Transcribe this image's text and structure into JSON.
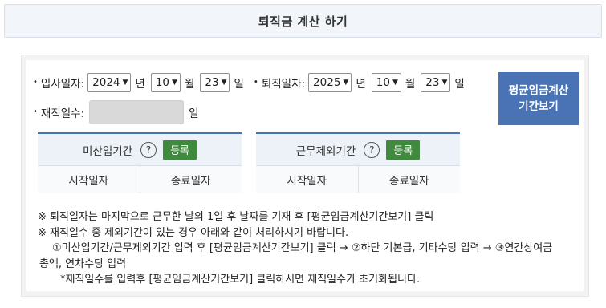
{
  "header": {
    "title": "퇴직금 계산 하기"
  },
  "dates": {
    "start_label": "입사일자:",
    "start_year": "2024",
    "start_month": "10",
    "start_day": "23",
    "end_label": "퇴직일자:",
    "end_year": "2025",
    "end_month": "10",
    "end_day": "23",
    "unit_year": "년",
    "unit_month": "월",
    "unit_day": "일",
    "bullet": "•"
  },
  "service_days": {
    "label": "재직일수:",
    "value": "",
    "unit": "일"
  },
  "avg_button": {
    "label": "평균임금계산\n기간보기"
  },
  "box_probation": {
    "title": "미산입기간",
    "help": "?",
    "register": "등록",
    "col_start": "시작일자",
    "col_end": "종료일자"
  },
  "box_excluded": {
    "title": "근무제외기간",
    "help": "?",
    "register": "등록",
    "col_start": "시작일자",
    "col_end": "종료일자"
  },
  "notes": {
    "line1": "※ 퇴직일자는 마지막으로 근무한 날의 1일 후 날짜를 기재 후 [평균임금계산기간보기] 클릭",
    "line2": "※ 재직일수 중 제외기간이 있는 경우 아래와 같이 처리하시기 바랍니다.",
    "line3": "①미산입기간/근무제외기간 입력 후 [평균임금계산기간보기] 클릭 → ②하단 기본급, 기타수당 입력 → ③연간상여금",
    "line4": "총액, 연차수당 입력",
    "line5": "*재직일수를 입력후 [평균임금계산기간보기] 클릭하시면 재직일수가 초기화됩니다."
  },
  "colors": {
    "accent_blue": "#4a73b5",
    "register_green": "#3f8a3f",
    "header_bg": "#f2f6fb"
  }
}
